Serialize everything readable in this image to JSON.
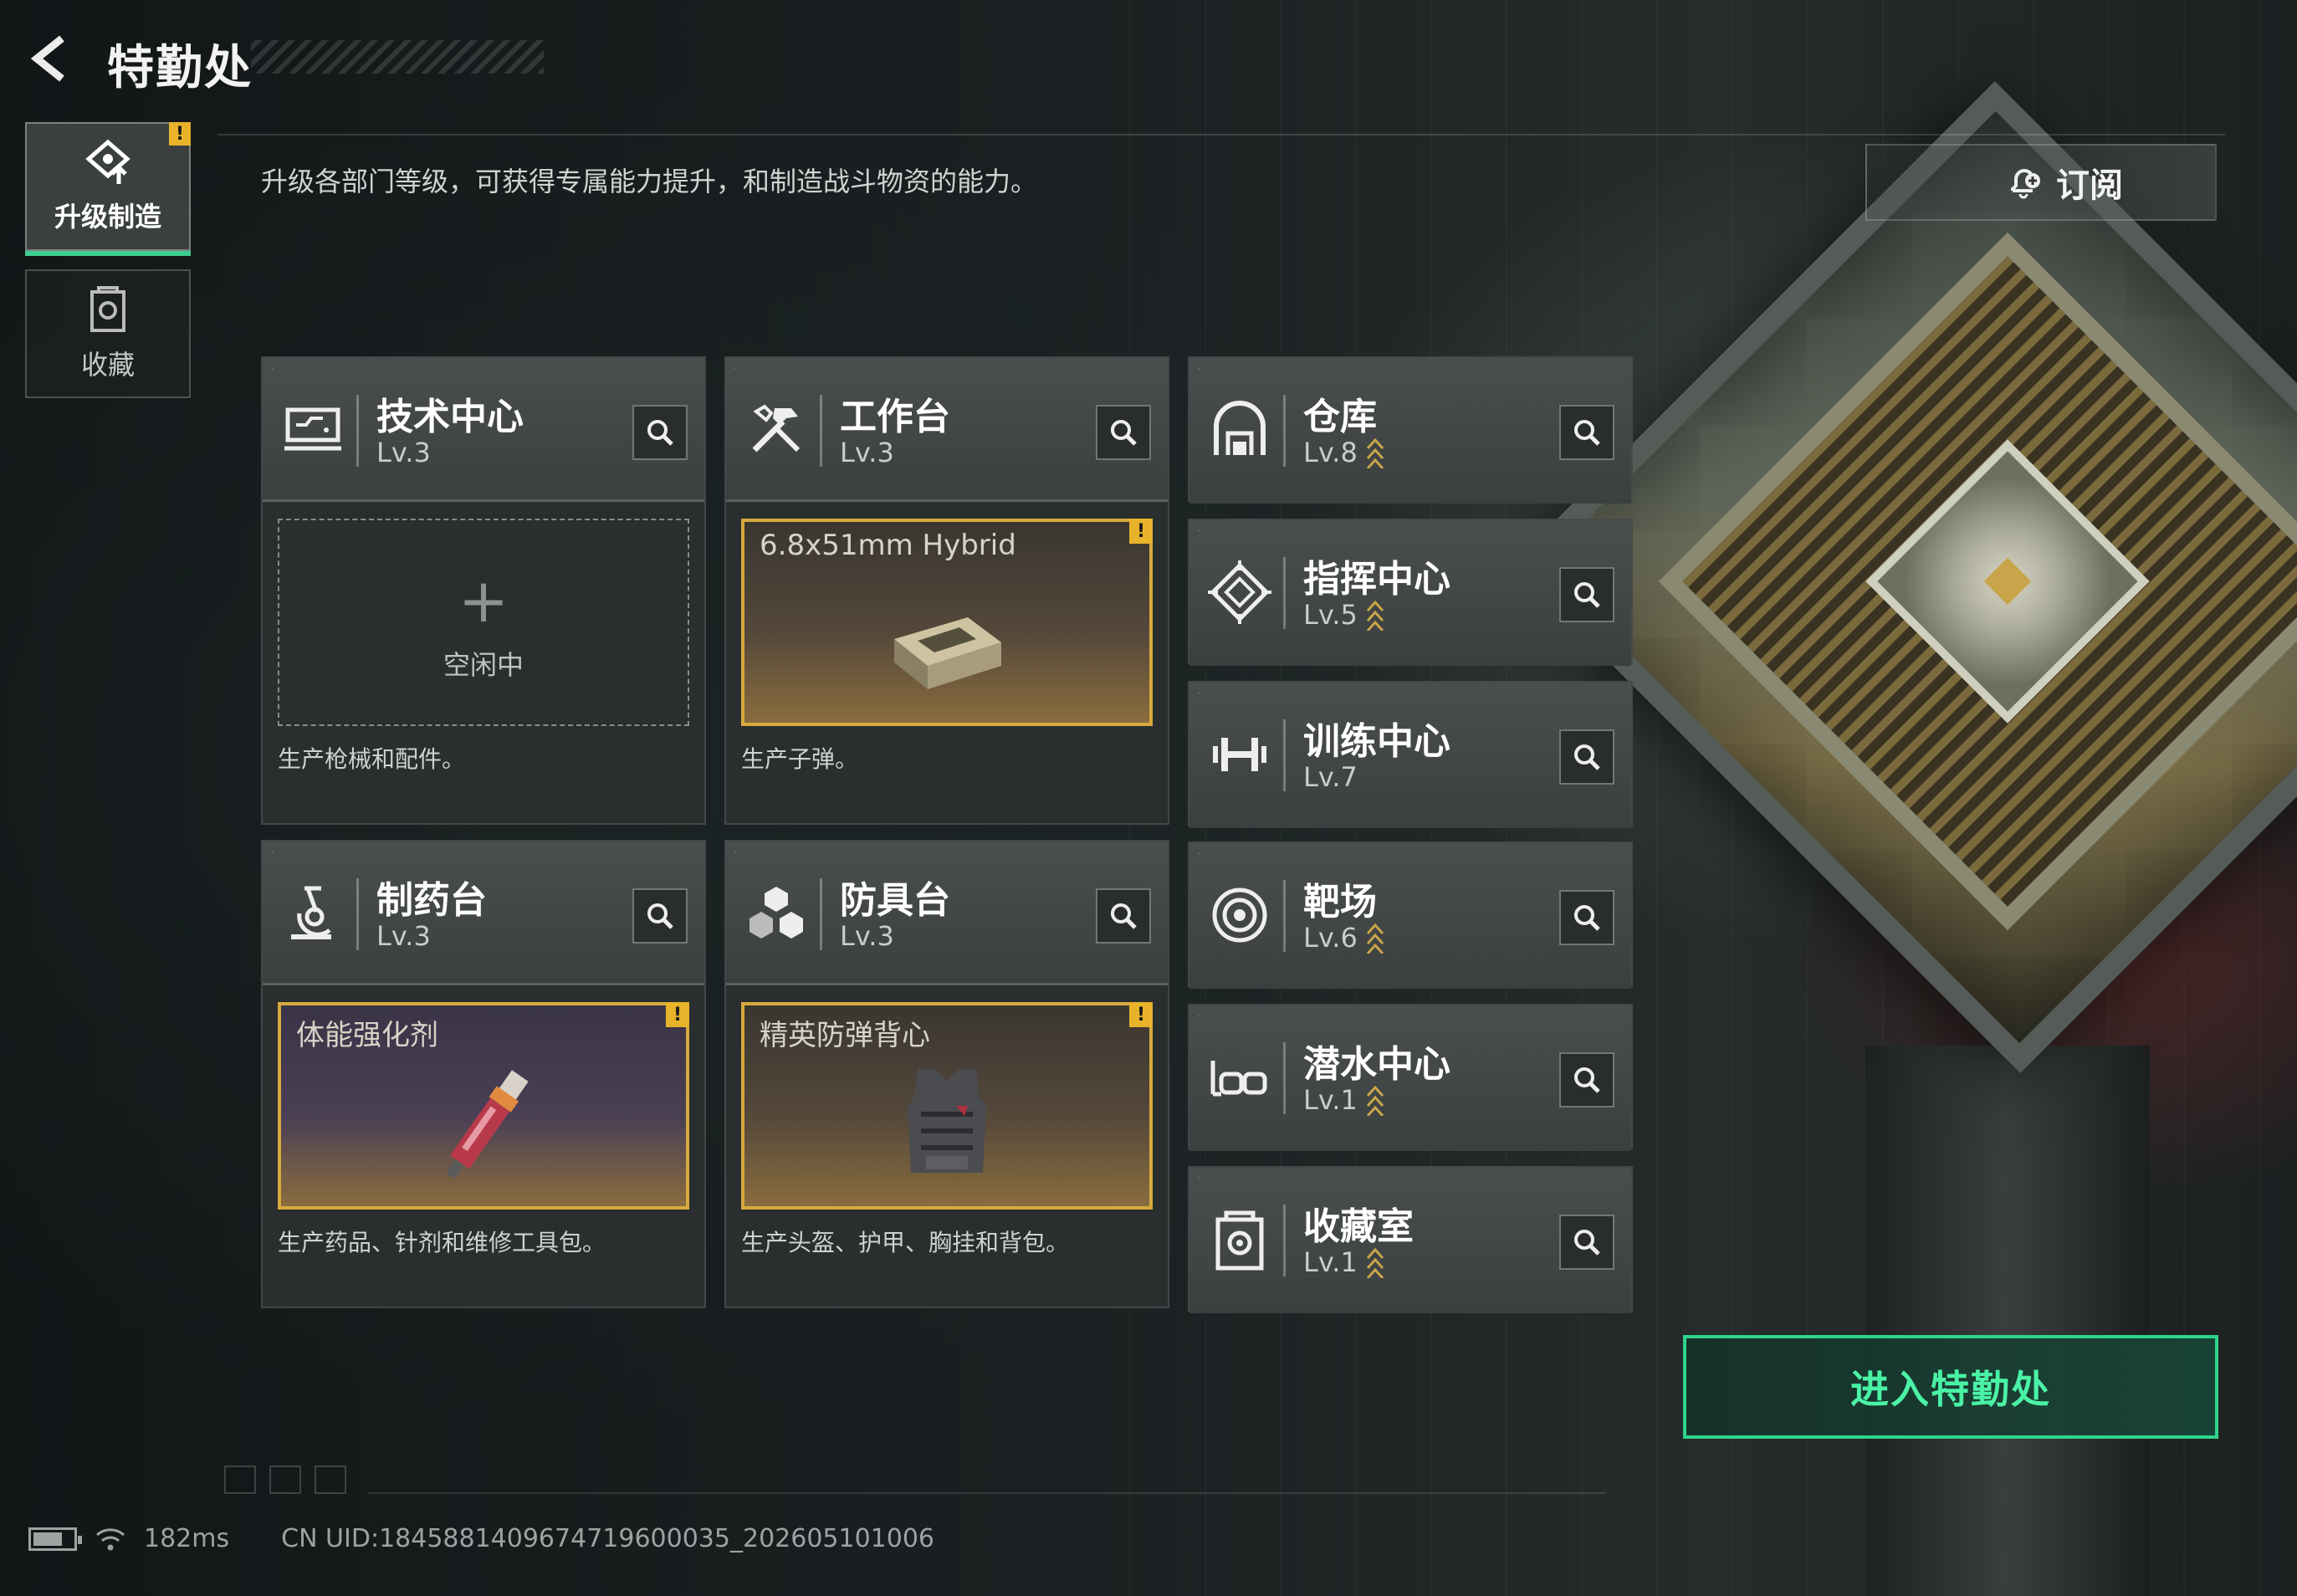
{
  "header": {
    "title": "特勤处",
    "description": "升级各部门等级，可获得专属能力提升，和制造战斗物资的能力。",
    "subscribe_label": "订阅"
  },
  "sidebar": {
    "items": [
      {
        "label": "升级制造",
        "icon": "upgrade-craft-icon",
        "active": true,
        "alert": "!"
      },
      {
        "label": "收藏",
        "icon": "collection-icon",
        "active": false
      }
    ]
  },
  "workshops": [
    {
      "name": "技术中心",
      "level": "Lv.3",
      "icon": "tech-center-icon",
      "slot": {
        "state": "idle",
        "label": "空闲中"
      },
      "desc": "生产枪械和配件。"
    },
    {
      "name": "工作台",
      "level": "Lv.3",
      "icon": "workbench-icon",
      "slot": {
        "state": "producing",
        "item": "6.8x51mm Hybrid",
        "alert": "!"
      },
      "desc": "生产子弹。"
    },
    {
      "name": "制药台",
      "level": "Lv.3",
      "icon": "pharmacy-icon",
      "slot": {
        "state": "producing",
        "item": "体能强化剂",
        "alert": "!"
      },
      "desc": "生产药品、针剂和维修工具包。"
    },
    {
      "name": "防具台",
      "level": "Lv.3",
      "icon": "armor-bench-icon",
      "slot": {
        "state": "producing",
        "item": "精英防弹背心",
        "alert": "!"
      },
      "desc": "生产头盔、护甲、胸挂和背包。"
    }
  ],
  "facilities": [
    {
      "name": "仓库",
      "level": "Lv.8",
      "icon": "warehouse-icon",
      "upgradable": true
    },
    {
      "name": "指挥中心",
      "level": "Lv.5",
      "icon": "command-center-icon",
      "upgradable": true
    },
    {
      "name": "训练中心",
      "level": "Lv.7",
      "icon": "training-center-icon",
      "upgradable": false
    },
    {
      "name": "靶场",
      "level": "Lv.6",
      "icon": "shooting-range-icon",
      "upgradable": true
    },
    {
      "name": "潜水中心",
      "level": "Lv.1",
      "icon": "diving-center-icon",
      "upgradable": true
    },
    {
      "name": "收藏室",
      "level": "Lv.1",
      "icon": "collection-room-icon",
      "upgradable": true
    }
  ],
  "enter_button": "进入特勤处",
  "status": {
    "ping": "182ms",
    "uid": "CN UID:1845881409674719600035_202605101006"
  },
  "colors": {
    "accent_green": "#2fd48c",
    "alert_yellow": "#e8b32a",
    "slot_gold": "#d7aa3e"
  }
}
